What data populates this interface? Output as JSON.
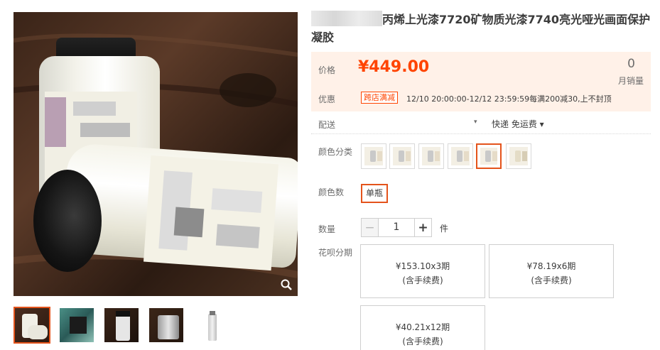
{
  "product": {
    "title": "丙烯上光漆7720矿物质光漆7740亮光哑光画面保护凝胶"
  },
  "gallery": {
    "zoom_icon": "magnifier-icon",
    "thumbnails": [
      {
        "icon": "jars-photo"
      },
      {
        "icon": "teal-tin-photo"
      },
      {
        "icon": "black-bottle-photo"
      },
      {
        "icon": "silver-jar-photo"
      },
      {
        "icon": "clear-bottle-photo"
      }
    ]
  },
  "price": {
    "label": "价格",
    "value": "¥449.00",
    "monthly_sales_count": "0",
    "monthly_sales_label": "月销量"
  },
  "promotion": {
    "label": "优惠",
    "badge": "跨店满减",
    "text": "12/10 20:00:00-12/12 23:59:59每满200减30,上不封顶"
  },
  "shipping": {
    "label": "配送",
    "method": "快递 免运费 ▾",
    "dropdown_arrow": "▾"
  },
  "colors": {
    "label": "颜色分类",
    "selected_index": 4
  },
  "color_count": {
    "label": "颜色数",
    "option": "单瓶"
  },
  "quantity": {
    "label": "数量",
    "minus": "−",
    "value": "1",
    "plus": "+",
    "unit": "件"
  },
  "installments": {
    "label": "花呗分期",
    "options": [
      {
        "amount": "¥153.10x3期",
        "fee": "(含手续费)"
      },
      {
        "amount": "¥78.19x6期",
        "fee": "(含手续费)"
      },
      {
        "amount": "¥40.21x12期",
        "fee": "(含手续费)"
      }
    ]
  },
  "theme": {
    "accent": "#ff4400",
    "selected_border": "#e4531b",
    "price_bg": "#fff1e8"
  }
}
